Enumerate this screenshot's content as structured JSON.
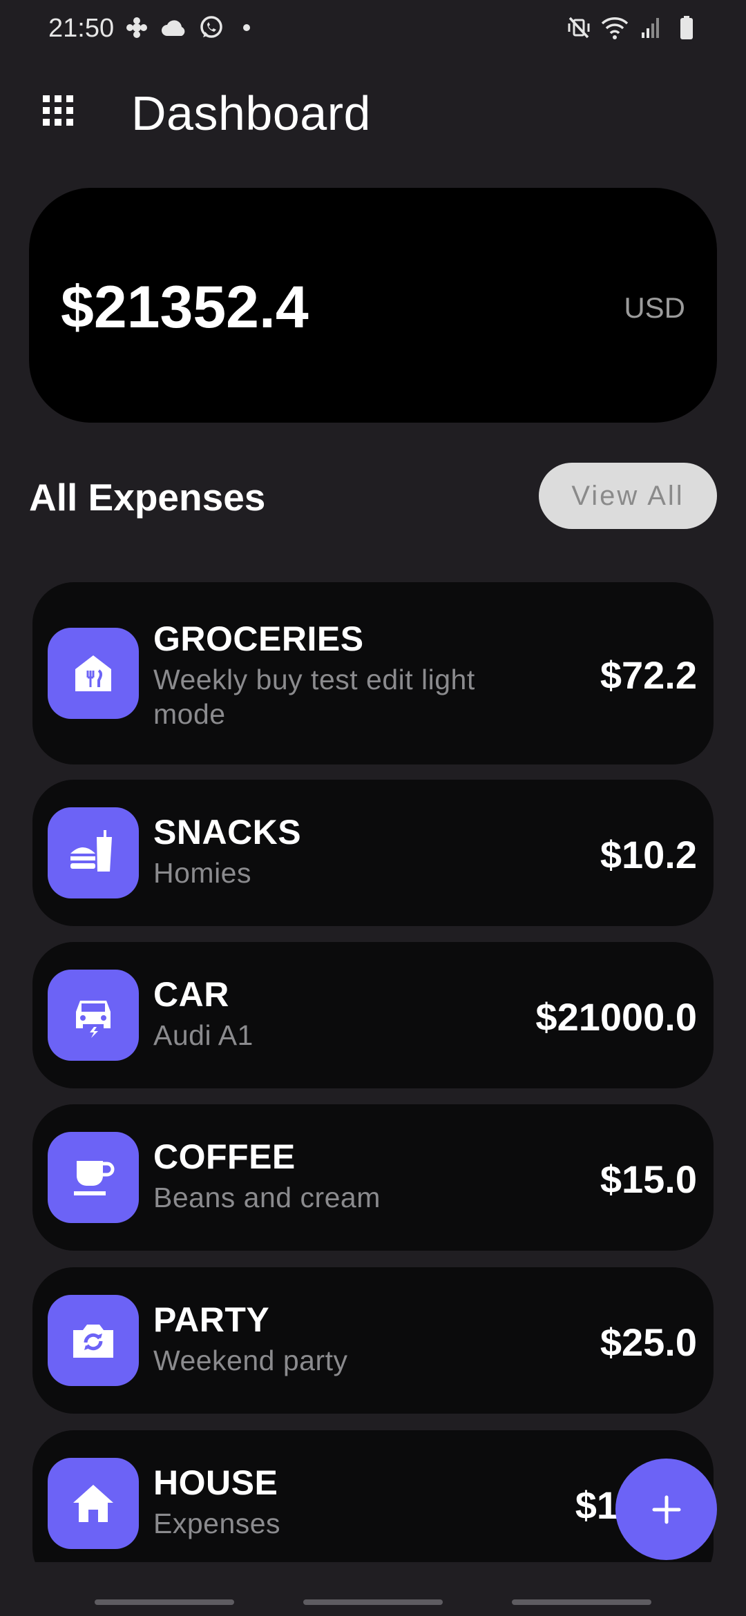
{
  "status_bar": {
    "time": "21:50",
    "left_icons": [
      "flower-notification-icon",
      "cloud-icon",
      "whatsapp-icon",
      "dot-icon"
    ],
    "right_icons": [
      "mute-vibrate-icon",
      "wifi-icon",
      "signal-icon",
      "battery-icon"
    ]
  },
  "header": {
    "title": "Dashboard",
    "menu_icon": "grid-menu-icon"
  },
  "balance": {
    "amount": "$21352.4",
    "currency": "USD"
  },
  "expenses_section": {
    "title": "All Expenses",
    "view_all_label": "View All"
  },
  "expenses": [
    {
      "name": "GROCERIES",
      "description": "Weekly buy test edit light mode",
      "amount": "$72.2",
      "icon": "storefront-icon"
    },
    {
      "name": "SNACKS",
      "description": "Homies",
      "amount": "$10.2",
      "icon": "fastfood-icon"
    },
    {
      "name": "CAR",
      "description": "Audi A1",
      "amount": "$21000.0",
      "icon": "electric-car-icon"
    },
    {
      "name": "COFFEE",
      "description": "Beans and cream",
      "amount": "$15.0",
      "icon": "coffee-icon"
    },
    {
      "name": "PARTY",
      "description": "Weekend party",
      "amount": "$25.0",
      "icon": "camera-icon"
    },
    {
      "name": "HOUSE",
      "description": "Expenses",
      "amount": "$1",
      "icon": "house-icon"
    }
  ],
  "fab": {
    "icon": "plus-icon"
  },
  "colors": {
    "background": "#201e22",
    "card": "#0b0b0c",
    "accent": "#6c63f6",
    "secondary_text": "#8b8b8e"
  }
}
